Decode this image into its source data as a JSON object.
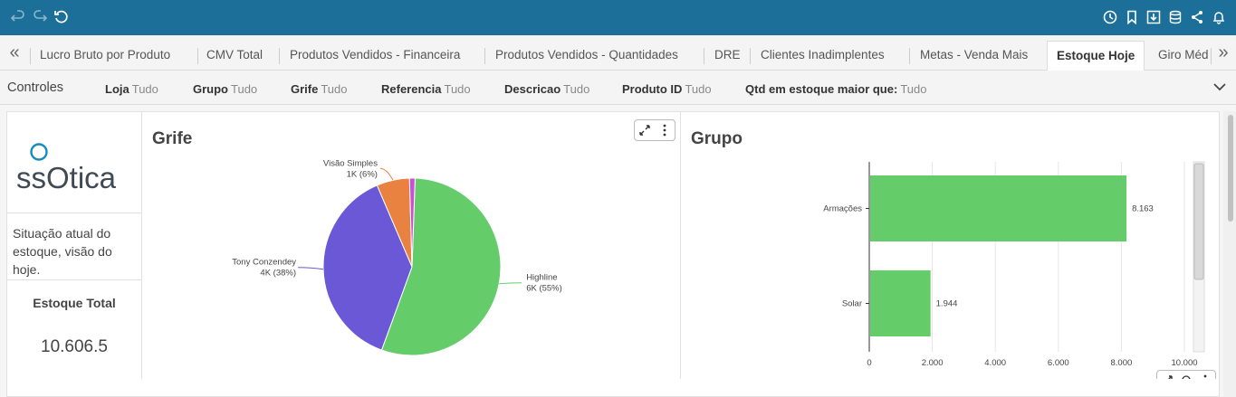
{
  "toolbar": {
    "left_icons": [
      "undo-icon",
      "redo-icon",
      "refresh-icon"
    ],
    "right_icons": [
      "clock-icon",
      "bookmark-icon",
      "download-icon",
      "database-icon",
      "share-icon",
      "bell-icon"
    ]
  },
  "tabs": [
    {
      "label": "Lucro Bruto por Produto"
    },
    {
      "label": "CMV Total"
    },
    {
      "label": "Produtos Vendidos - Financeira"
    },
    {
      "label": "Produtos Vendidos - Quantidades"
    },
    {
      "label": "DRE"
    },
    {
      "label": "Clientes Inadimplentes"
    },
    {
      "label": "Metas - Venda Mais"
    },
    {
      "label": "Estoque Hoje",
      "active": true
    },
    {
      "label": "Giro Méd"
    }
  ],
  "controls": {
    "title": "Controles",
    "filters": [
      {
        "key": "Loja",
        "value": "Tudo"
      },
      {
        "key": "Grupo",
        "value": "Tudo"
      },
      {
        "key": "Grife",
        "value": "Tudo"
      },
      {
        "key": "Referencia",
        "value": "Tudo"
      },
      {
        "key": "Descricao",
        "value": "Tudo"
      },
      {
        "key": "Produto ID",
        "value": "Tudo"
      },
      {
        "key": "Qtd em estoque maior que:",
        "value": "Tudo"
      }
    ]
  },
  "left_panel": {
    "logo_text": "ssOtica",
    "description": "Situação atual do estoque, visão do hoje.",
    "total_label": "Estoque Total",
    "total_value": "10.606.5"
  },
  "chart_data": [
    {
      "type": "pie",
      "title": "Grife",
      "slices": [
        {
          "label": "Highline",
          "value_label": "6K (55%)",
          "value": 55,
          "color": "#64cd6a"
        },
        {
          "label": "Tony Conzendey",
          "value_label": "4K (38%)",
          "value": 38,
          "color": "#6b58d6"
        },
        {
          "label": "Visão Simples",
          "value_label": "1K (6%)",
          "value": 6,
          "color": "#e98140"
        },
        {
          "label": "",
          "value_label": "",
          "value": 1,
          "color": "#c94fd8"
        }
      ]
    },
    {
      "type": "bar",
      "orientation": "horizontal",
      "title": "Grupo",
      "categories": [
        "Armações",
        "Solar"
      ],
      "values": [
        8163,
        1944
      ],
      "value_labels": [
        "8.163",
        "1.944"
      ],
      "xlim": [
        0,
        10000
      ],
      "xticks": [
        "0",
        "2.000",
        "4.000",
        "6.000",
        "8.000",
        "10.000"
      ],
      "grid": true,
      "color": "#64cd6a"
    }
  ]
}
